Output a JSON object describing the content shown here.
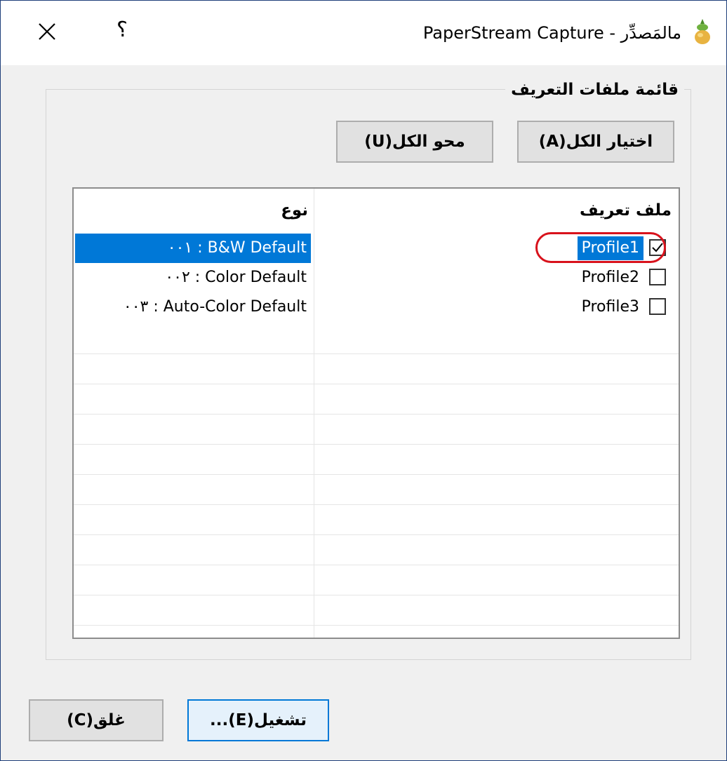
{
  "window": {
    "title": "PaperStream Capture - مالمَصدِّر",
    "help_label": "؟"
  },
  "group": {
    "title": "قائمة ملفات التعريف",
    "select_all_label": "اختيار الكل(A)",
    "clear_all_label": "محو الكل(U)"
  },
  "list": {
    "columns": {
      "profile": "ملف تعريف",
      "type": "نوع"
    },
    "rows": [
      {
        "profile": "Profile1",
        "type": "B&W Default : ٠٠١",
        "checked": true,
        "selected": true
      },
      {
        "profile": "Profile2",
        "type": "Color Default : ٠٠٢",
        "checked": false,
        "selected": false
      },
      {
        "profile": "Profile3",
        "type": "Auto-Color Default : ٠٠٣",
        "checked": false,
        "selected": false
      }
    ]
  },
  "footer": {
    "run_label": "تشغيل(E)...",
    "close_label": "غلق(C)"
  },
  "colors": {
    "selection": "#0078d7",
    "highlight_circle": "#d8121c",
    "window_border": "#1f3f7a"
  }
}
